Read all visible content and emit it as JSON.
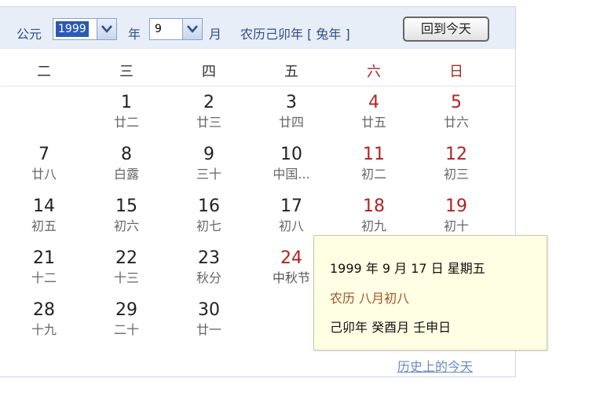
{
  "header": {
    "gongyuan_label": "公元",
    "year_value": "1999",
    "year_suffix": "年",
    "month_value": "9",
    "month_suffix": "月",
    "lunar_year_text": "农历己卯年 [ 兔年 ]",
    "today_button": "回到今天"
  },
  "weekdays": [
    "二",
    "三",
    "四",
    "五",
    "六",
    "日"
  ],
  "days": [
    {
      "num": "1",
      "lunar": "廿二"
    },
    {
      "num": "2",
      "lunar": "廿三"
    },
    {
      "num": "3",
      "lunar": "廿四"
    },
    {
      "num": "4",
      "lunar": "廿五"
    },
    {
      "num": "5",
      "lunar": "廿六"
    },
    {
      "num": "7",
      "lunar": "廿八"
    },
    {
      "num": "8",
      "lunar": "白露"
    },
    {
      "num": "9",
      "lunar": "三十"
    },
    {
      "num": "10",
      "lunar": "中国..."
    },
    {
      "num": "11",
      "lunar": "初二"
    },
    {
      "num": "12",
      "lunar": "初三"
    },
    {
      "num": "14",
      "lunar": "初五"
    },
    {
      "num": "15",
      "lunar": "初六"
    },
    {
      "num": "16",
      "lunar": "初七"
    },
    {
      "num": "17",
      "lunar": "初八"
    },
    {
      "num": "18",
      "lunar": "初九"
    },
    {
      "num": "19",
      "lunar": "初十"
    },
    {
      "num": "21",
      "lunar": "十二"
    },
    {
      "num": "22",
      "lunar": "十三"
    },
    {
      "num": "23",
      "lunar": "秋分"
    },
    {
      "num": "24",
      "lunar": "中秋节"
    },
    {
      "num": "28",
      "lunar": "十九"
    },
    {
      "num": "29",
      "lunar": "二十"
    },
    {
      "num": "30",
      "lunar": "廿一"
    }
  ],
  "tooltip": {
    "line1": "1999 年 9 月 17 日 星期五",
    "line2": "农历 八月初八",
    "line3": "己卯年 癸酉月 壬申日"
  },
  "footer": {
    "history_link": "历史上的今天"
  },
  "colors": {
    "header_bg": "#e8eef8",
    "weekend_red": "#b22222",
    "selected_year_bg": "#2a5ab4",
    "tooltip_bg": "#ffffe3",
    "link": "#6b8ac0"
  }
}
